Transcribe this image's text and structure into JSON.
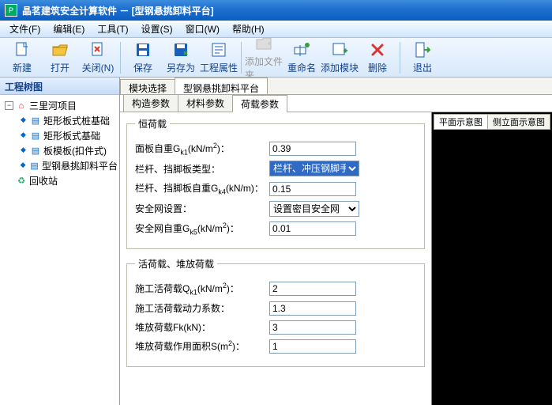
{
  "window": {
    "app_icon_char": "P",
    "title": "晶茗建筑安全计算软件 － [型钢悬挑卸料平台]"
  },
  "menu": [
    "文件(F)",
    "编辑(E)",
    "工具(T)",
    "设置(S)",
    "窗口(W)",
    "帮助(H)"
  ],
  "toolbar": [
    {
      "label": "新建",
      "icon": "new",
      "disabled": false
    },
    {
      "label": "打开",
      "icon": "open",
      "disabled": false
    },
    {
      "label": "关闭(N)",
      "icon": "close",
      "disabled": false
    },
    {
      "sep": true
    },
    {
      "label": "保存",
      "icon": "save",
      "disabled": false
    },
    {
      "label": "另存为",
      "icon": "saveas",
      "disabled": false
    },
    {
      "label": "工程属性",
      "icon": "props",
      "disabled": false
    },
    {
      "sep": true
    },
    {
      "label": "添加文件夹",
      "icon": "addfolder",
      "disabled": true
    },
    {
      "label": "重命名",
      "icon": "rename",
      "disabled": false
    },
    {
      "label": "添加模块",
      "icon": "addmod",
      "disabled": false
    },
    {
      "label": "删除",
      "icon": "delete",
      "disabled": false
    },
    {
      "sep": true
    },
    {
      "label": "退出",
      "icon": "exit",
      "disabled": false
    }
  ],
  "sidebar": {
    "title": "工程树图",
    "root": "三里河项目",
    "children": [
      "矩形板式桩基础",
      "矩形板式基础",
      "板模板(扣件式)",
      "型钢悬挑卸料平台"
    ],
    "recycle": "回收站"
  },
  "tabs_top": {
    "items": [
      "模块选择",
      "型钢悬挑卸料平台"
    ],
    "active": 1
  },
  "tabs_sub": {
    "items": [
      "构造参数",
      "材料参数",
      "荷载参数"
    ],
    "active": 2
  },
  "view_tabs": {
    "items": [
      "平面示意图",
      "侧立面示意图"
    ],
    "active": 0
  },
  "form": {
    "group1": {
      "legend": "恒荷载",
      "rows": [
        {
          "label_pre": "面板自重G",
          "label_sub": "k1",
          "label_unit": "(kN/m",
          "label_sup": "2",
          "label_post": ")：",
          "type": "text",
          "value": "0.39"
        },
        {
          "label_pre": "栏杆、挡脚板类型：",
          "type": "select_hl",
          "value": "栏杆、冲压钢脚手"
        },
        {
          "label_pre": "栏杆、挡脚板自重G",
          "label_sub": "k4",
          "label_unit": "(kN/m)：",
          "type": "text",
          "value": "0.15"
        },
        {
          "label_pre": "安全网设置：",
          "type": "select",
          "value": "设置密目安全网"
        },
        {
          "label_pre": "安全网自重G",
          "label_sub": "k5",
          "label_unit": "(kN/m",
          "label_sup": "2",
          "label_post": ")：",
          "type": "text",
          "value": "0.01"
        }
      ]
    },
    "group2": {
      "legend": "活荷载、堆放荷载",
      "rows": [
        {
          "label_pre": "施工活荷载Q",
          "label_sub": "k1",
          "label_unit": "(kN/m",
          "label_sup": "2",
          "label_post": ")：",
          "type": "text",
          "value": "2"
        },
        {
          "label_pre": "施工活荷载动力系数：",
          "type": "text",
          "value": "1.3"
        },
        {
          "label_pre": "堆放荷载Fk(kN)：",
          "type": "text",
          "value": "3"
        },
        {
          "label_pre": "堆放荷载作用面积S(m",
          "label_sup": "2",
          "label_post": ")：",
          "type": "text",
          "value": "1"
        }
      ]
    }
  }
}
